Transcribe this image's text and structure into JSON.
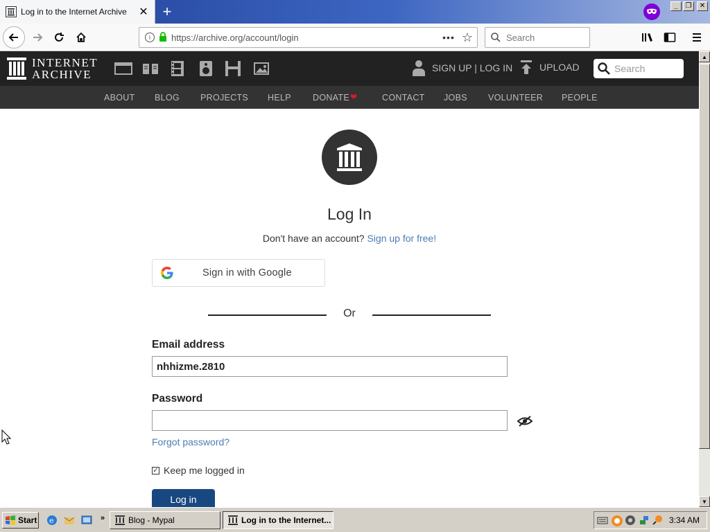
{
  "browser": {
    "tab_title": "Log in to the Internet Archive",
    "url": "https://archive.org/account/login",
    "search_placeholder": "Search"
  },
  "ia_header": {
    "logo_line1": "INTERNET",
    "logo_line2": "ARCHIVE",
    "media_icons": [
      "web-icon",
      "texts-icon",
      "video-icon",
      "audio-icon",
      "software-icon",
      "images-icon"
    ],
    "account_label": "SIGN UP | LOG IN",
    "upload_label": "UPLOAD",
    "search_placeholder": "Search",
    "menu": [
      "ABOUT",
      "BLOG",
      "PROJECTS",
      "HELP",
      "DONATE",
      "CONTACT",
      "JOBS",
      "VOLUNTEER",
      "PEOPLE"
    ],
    "donate_heart_color": "#e0182d"
  },
  "login": {
    "title": "Log In",
    "no_account_text": "Don't have an account?",
    "signup_link": "Sign up for free!",
    "google_button": "Sign in with Google",
    "or_text": "Or",
    "email_label": "Email address",
    "email_value": "nhhizme.2810",
    "password_label": "Password",
    "password_value": "",
    "forgot_link": "Forgot password?",
    "keep_logged_in": "Keep me logged in",
    "keep_checked": true,
    "submit_label": "Log in"
  },
  "taskbar": {
    "start_label": "Start",
    "tasks": [
      {
        "label": "Blog - Mypal",
        "active": false
      },
      {
        "label": "Log in to the Internet...",
        "active": true
      }
    ],
    "clock": "3:34 AM"
  },
  "colors": {
    "ia_header_bg": "#222222",
    "ia_menu_bg": "#333333",
    "link": "#4b7cb4",
    "login_button": "#194880"
  }
}
